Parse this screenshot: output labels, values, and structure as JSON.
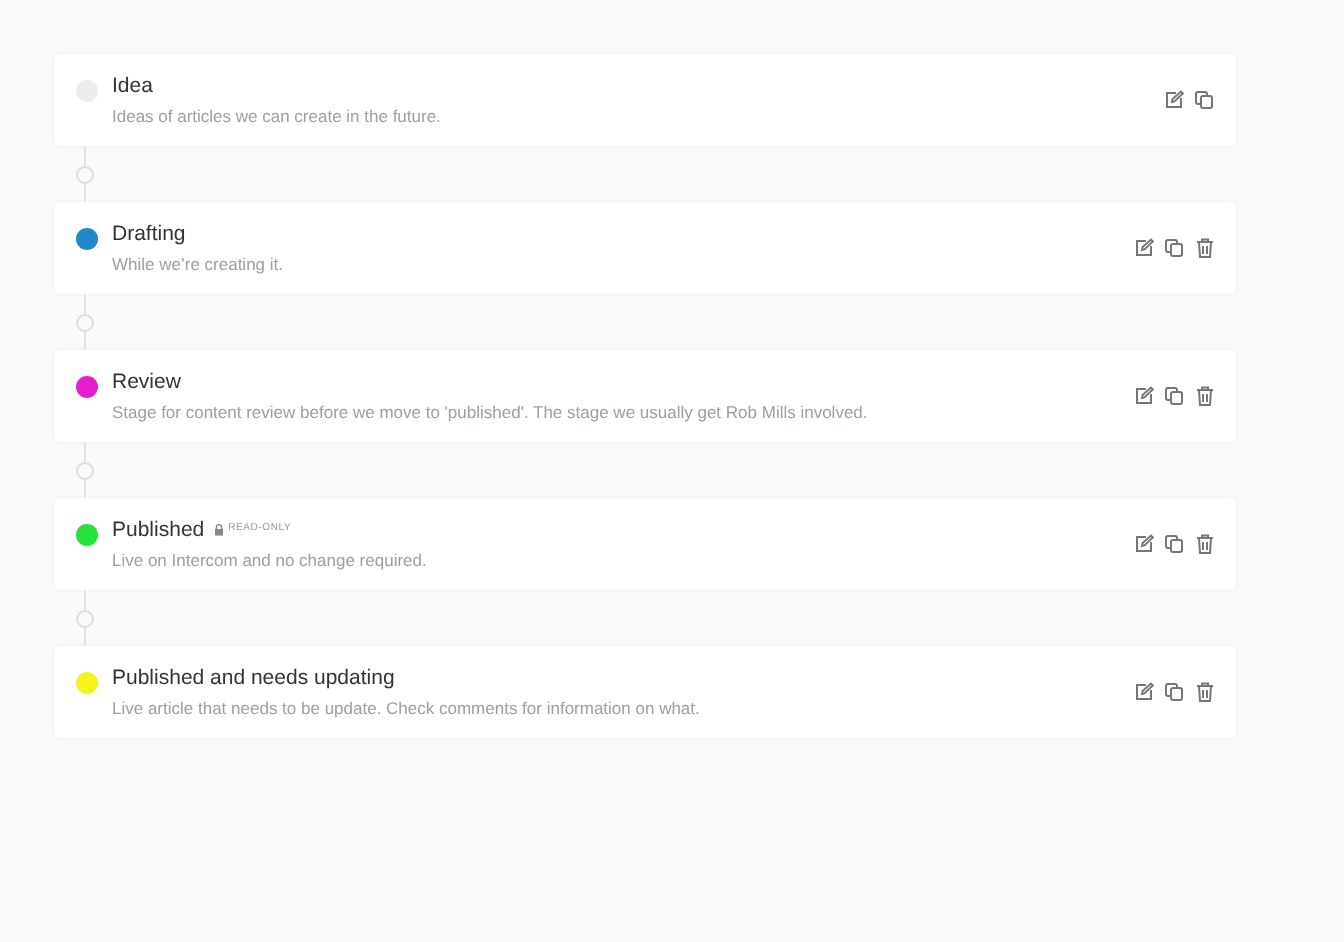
{
  "stages": [
    {
      "name": "Idea",
      "description": "Ideas of articles we can create in the future.",
      "color": "#ececec",
      "deletable": false
    },
    {
      "name": "Drafting",
      "description": "While we’re creating it.",
      "color": "#1e88c8",
      "deletable": true
    },
    {
      "name": "Review",
      "description": "Stage for content review before we move to 'published'. The stage we usually get Rob Mills involved.",
      "color": "#e61ccf",
      "deletable": true
    },
    {
      "name": "Published",
      "description": "Live on Intercom and no change required.",
      "color": "#22e33a",
      "deletable": true,
      "badge": "READ-ONLY"
    },
    {
      "name": "Published and needs updating",
      "description": "Live article that needs to be update. Check comments for information on what.",
      "color": "#f5f51e",
      "deletable": true
    }
  ]
}
